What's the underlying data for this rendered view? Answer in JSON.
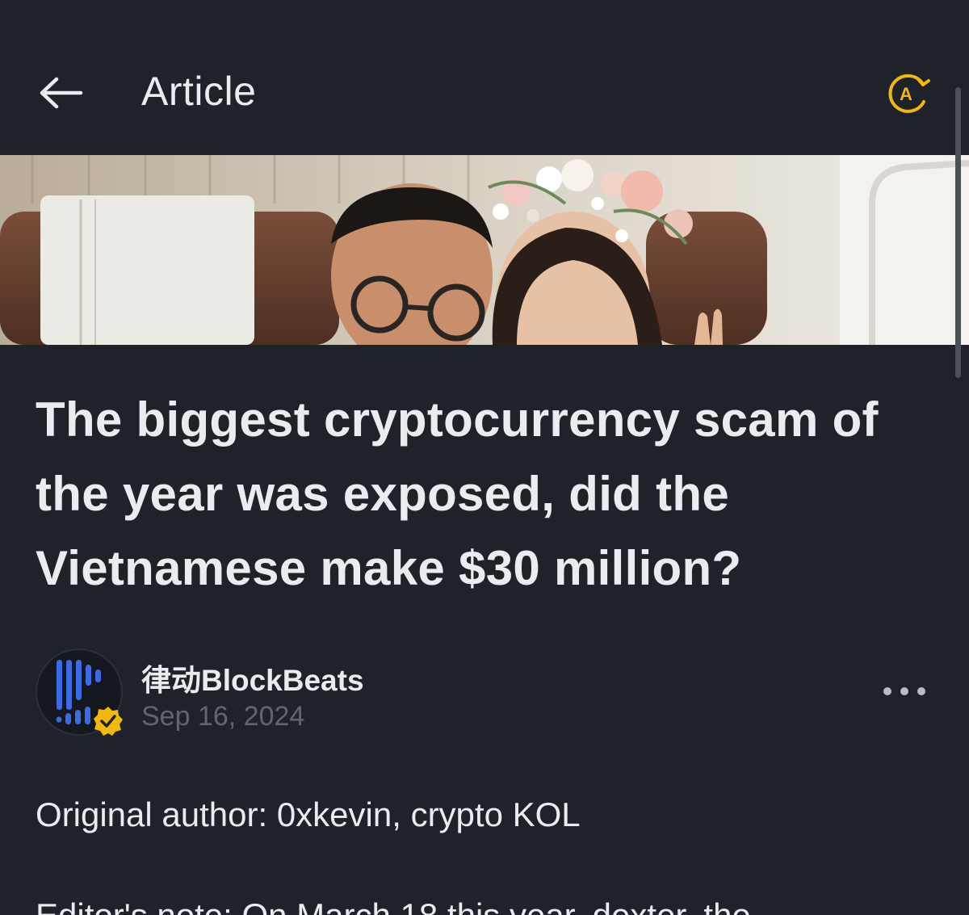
{
  "header": {
    "title": "Article",
    "back_icon": "arrow-left-icon",
    "translate_icon": "translate-icon",
    "translate_glyph": "A"
  },
  "article": {
    "headline": "The biggest cryptocurrency scam of the year was exposed, did the Vietnamese make $30 million?",
    "author": {
      "name": "律动BlockBeats",
      "date": "Sep 16, 2024",
      "verified": true
    },
    "paragraphs": [
      "Original author: 0xkevin, crypto KOL",
      "Editor's note: On March 18 this year, dexter, the"
    ]
  },
  "colors": {
    "background": "#1f2229",
    "accent": "#f0b90b",
    "text_primary": "#eaecef",
    "text_muted": "#5e6673"
  }
}
